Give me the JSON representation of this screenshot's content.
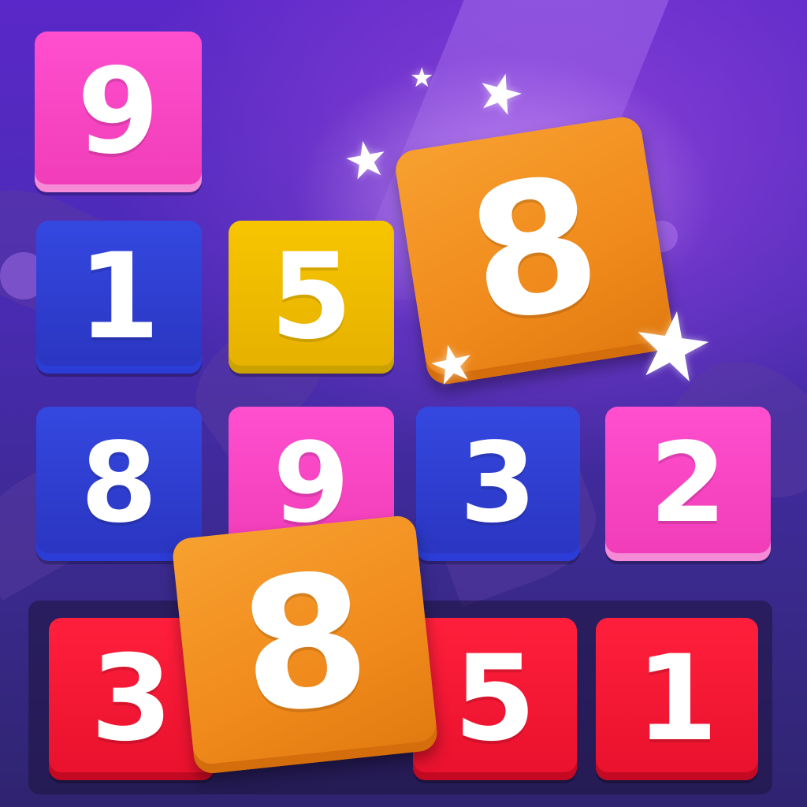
{
  "board": {
    "rows": [
      {
        "tiles": [
          {
            "value": "9",
            "color": "pink"
          }
        ]
      },
      {
        "tiles": [
          {
            "value": "1",
            "color": "blue"
          },
          {
            "value": "5",
            "color": "yellow"
          }
        ]
      },
      {
        "tiles": [
          {
            "value": "8",
            "color": "blue"
          },
          {
            "value": "9",
            "color": "pink"
          },
          {
            "value": "3",
            "color": "blue"
          },
          {
            "value": "2",
            "color": "pink"
          }
        ]
      }
    ],
    "floating_tile": {
      "value": "8",
      "color": "orange"
    }
  },
  "tray": {
    "tiles": [
      {
        "value": "3",
        "color": "red"
      },
      {
        "value": "5",
        "color": "red"
      },
      {
        "value": "1",
        "color": "red"
      }
    ],
    "dragging_tile": {
      "value": "8",
      "color": "orange"
    }
  },
  "colors": {
    "pink": "#f03cb7",
    "blue": "#2a35c0",
    "yellow": "#e6b000",
    "red": "#e8112d",
    "orange": "#f08a1c",
    "background": "#4a2bb5"
  },
  "decor": {
    "star_icon": "star-icon",
    "star_glyph": "★"
  }
}
